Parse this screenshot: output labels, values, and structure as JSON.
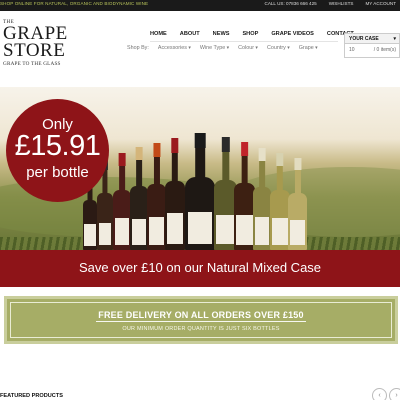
{
  "topbar": {
    "tagline": "SHOP ONLINE FOR NATURAL, ORGANIC AND BIODYNAMIC WINE",
    "call": "CALL US: 07836 666 425",
    "wishlists": "WISHLISTS",
    "account": "MY ACCOUNT"
  },
  "logo": {
    "the": "THE",
    "line1": "GRAPE",
    "line2": "STORE",
    "tagline": "GRAPE TO THE GLASS"
  },
  "nav": {
    "items": [
      "HOME",
      "ABOUT",
      "NEWS",
      "SHOP",
      "GRAPE VIDEOS",
      "CONTACT"
    ]
  },
  "subnav": {
    "label": "Shop By:",
    "items": [
      "Accessories",
      "Wine Type",
      "Colour",
      "Country",
      "Grape"
    ]
  },
  "cart": {
    "title": "YOUR CASE",
    "qty": "10",
    "items_text": "/ 0 item(s)"
  },
  "hero": {
    "badge_only": "Only",
    "badge_price": "£15.91",
    "badge_per": "per bottle"
  },
  "banner": {
    "text": "Save over £10 on our Natural Mixed Case"
  },
  "delivery": {
    "title": "FREE DELIVERY ON ALL ORDERS OVER £150",
    "subtitle": "OUR MINIMUM ORDER QUANTITY IS JUST SIX BOTTLES"
  },
  "featured": {
    "title": "FEATURED PRODUCTS"
  },
  "colors": {
    "brand_red": "#8e1418",
    "olive": "#a6ad66",
    "topbar": "#1a1a1a"
  },
  "icons": {
    "prev": "chevron-left-icon",
    "next": "chevron-right-icon",
    "cart_toggle": "chevron-down-icon"
  }
}
